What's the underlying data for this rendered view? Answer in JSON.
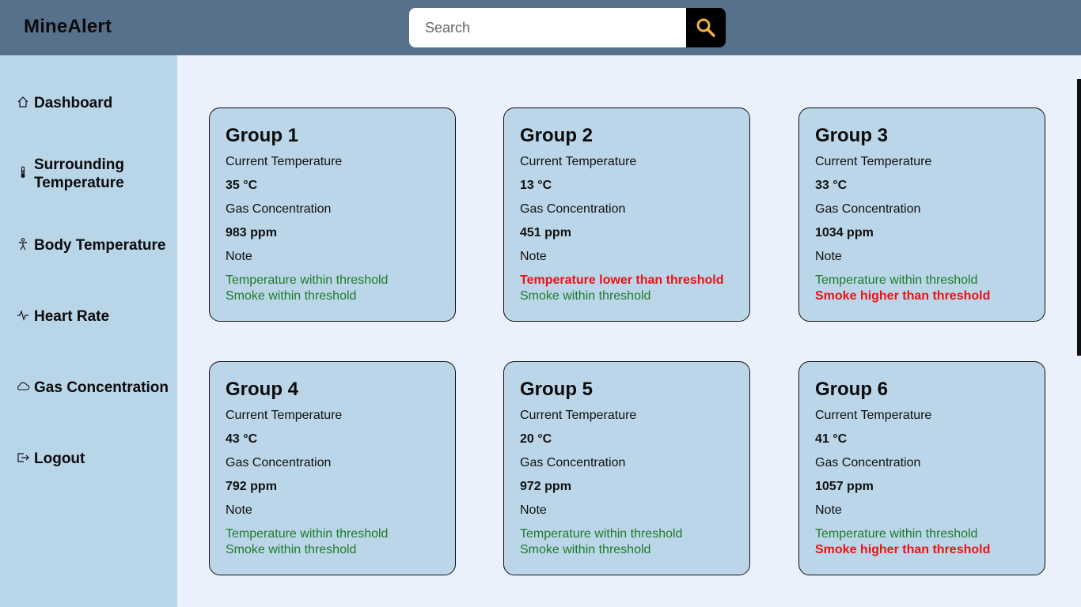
{
  "app": {
    "brand": "MineAlert"
  },
  "search": {
    "placeholder": "Search"
  },
  "sidebar": {
    "items": [
      {
        "label": "Dashboard",
        "icon": "home-icon"
      },
      {
        "label": "Surrounding Temperature",
        "icon": "thermometer-icon"
      },
      {
        "label": "Body Temperature",
        "icon": "person-icon"
      },
      {
        "label": "Heart Rate",
        "icon": "pulse-icon"
      },
      {
        "label": "Gas Concentration",
        "icon": "cloud-icon"
      },
      {
        "label": "Logout",
        "icon": "logout-icon"
      }
    ]
  },
  "labels": {
    "current_temperature": "Current Temperature",
    "gas_concentration": "Gas Concentration",
    "note": "Note"
  },
  "colors": {
    "ok": "#1f7a2b",
    "alert": "#ee1111",
    "header": "#58718b",
    "sidebar": "#b9d5e8",
    "card": "#bad6e8"
  },
  "groups": [
    {
      "title": "Group 1",
      "temperature": "35 °C",
      "gas": "983 ppm",
      "temp_status": {
        "text": "Temperature within threshold",
        "level": "ok"
      },
      "smoke_status": {
        "text": "Smoke within threshold",
        "level": "ok"
      }
    },
    {
      "title": "Group 2",
      "temperature": "13 °C",
      "gas": "451 ppm",
      "temp_status": {
        "text": "Temperature lower than threshold",
        "level": "bad"
      },
      "smoke_status": {
        "text": "Smoke within threshold",
        "level": "ok"
      }
    },
    {
      "title": "Group 3",
      "temperature": "33 °C",
      "gas": "1034 ppm",
      "temp_status": {
        "text": "Temperature within threshold",
        "level": "ok"
      },
      "smoke_status": {
        "text": "Smoke higher than threshold",
        "level": "bad"
      }
    },
    {
      "title": "Group 4",
      "temperature": "43 °C",
      "gas": "792 ppm",
      "temp_status": {
        "text": "Temperature within threshold",
        "level": "ok"
      },
      "smoke_status": {
        "text": "Smoke within threshold",
        "level": "ok"
      }
    },
    {
      "title": "Group 5",
      "temperature": "20 °C",
      "gas": "972 ppm",
      "temp_status": {
        "text": "Temperature within threshold",
        "level": "ok"
      },
      "smoke_status": {
        "text": "Smoke within threshold",
        "level": "ok"
      }
    },
    {
      "title": "Group 6",
      "temperature": "41 °C",
      "gas": "1057 ppm",
      "temp_status": {
        "text": "Temperature within threshold",
        "level": "ok"
      },
      "smoke_status": {
        "text": "Smoke higher than threshold",
        "level": "bad"
      }
    }
  ]
}
